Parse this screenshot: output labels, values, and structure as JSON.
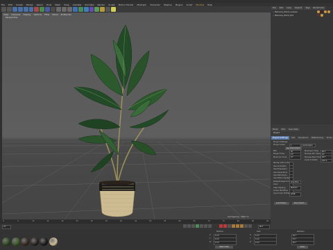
{
  "menu": {
    "items": [
      "File",
      "Edit",
      "Create",
      "Modes",
      "Select",
      "Tools",
      "Mesh",
      "Snap",
      "Animate",
      "Simulate",
      "Render",
      "Sculpt",
      "Motion Tracker",
      "MoGraph",
      "Character",
      "Pipeline",
      "Plugins",
      "Script",
      "Window",
      "Help"
    ],
    "highlight_index": 18
  },
  "viewport": {
    "menu": [
      "View",
      "Cameras",
      "Display",
      "Options",
      "Filter",
      "Panel",
      "ProRender"
    ],
    "label": "Perspective",
    "grid_spacing": "Grid Spacing : 1000 cm"
  },
  "object_manager": {
    "tabs": [
      "File",
      "Edit",
      "View",
      "Objects",
      "Tags",
      "Bookmarks"
    ],
    "rows": [
      "Banana_Plant_Leaves",
      "Banana_Plant_Pot"
    ]
  },
  "attributes": {
    "menu": [
      "Mode",
      "Edit",
      "User Data"
    ],
    "header": "Project",
    "tabs": [
      "Project Settings",
      "Info",
      "Dynamics",
      "Referencing",
      "To Do"
    ],
    "section": "Project Settings",
    "subtabs": [
      "Key Interpolation"
    ],
    "fields": [
      {
        "label": "Project Scale",
        "value": "1",
        "unit": "Centimeters"
      },
      {
        "label": "FPS",
        "value": "30"
      },
      {
        "label": "Project Time",
        "value": "0 F"
      },
      {
        "label": "Minimum Time",
        "value": "0 F"
      },
      {
        "label": "Maximum Time",
        "value": "90 F"
      },
      {
        "label": "Preview Min Time",
        "value": "0 F"
      },
      {
        "label": "Preview Max Time",
        "value": "90 F"
      },
      {
        "label": "Level of Detail",
        "value": "100 %"
      },
      {
        "label": "Render LOD in Editor"
      },
      {
        "label": "Use Animation"
      },
      {
        "label": "Use Expression"
      },
      {
        "label": "Use Generators"
      },
      {
        "label": "Use Deformers"
      },
      {
        "label": "Use Motion System"
      },
      {
        "label": "Default Object Color",
        "value": "Gray Blue"
      },
      {
        "label": "Color"
      },
      {
        "label": "View Clipping",
        "value": "Medium"
      },
      {
        "label": "Linear Workflow"
      },
      {
        "label": "Input Color Profile",
        "value": "sRGB"
      }
    ],
    "buttons": [
      "Load Preset...",
      "Save Preset..."
    ]
  },
  "timeline": {
    "frame_start": "0 F",
    "frame_end": "90 F",
    "ticks": [
      "0",
      "5",
      "10",
      "15",
      "20",
      "25",
      "30",
      "35",
      "40",
      "45",
      "50",
      "55",
      "60",
      "65",
      "70",
      "75",
      "80",
      "85",
      "90"
    ]
  },
  "coords": {
    "headers": [
      "Position",
      "Size",
      "Rotation"
    ],
    "rows": [
      {
        "axis": "X",
        "pos": "0 cm",
        "size": "0 cm",
        "rot": "H 0 °"
      },
      {
        "axis": "Y",
        "pos": "0 cm",
        "size": "0 cm",
        "rot": "P 0 °"
      },
      {
        "axis": "Z",
        "pos": "0 cm",
        "size": "0 cm",
        "rot": "B 0 °"
      }
    ],
    "mode": "Object (Rel)",
    "apply": "Apply"
  },
  "materials": [
    {
      "color": "#2f4a22"
    },
    {
      "color": "#3d5a28"
    },
    {
      "color": "#3a2a22"
    },
    {
      "color": "#2a2320"
    },
    {
      "color": "#1e1c1b"
    },
    {
      "color": "#cdbd98"
    }
  ],
  "colors": {
    "accent": "#5c7aa8",
    "leaf_dark": "#1f3a22",
    "leaf_light": "#3f6b3a",
    "pot": "#cdbb92"
  }
}
